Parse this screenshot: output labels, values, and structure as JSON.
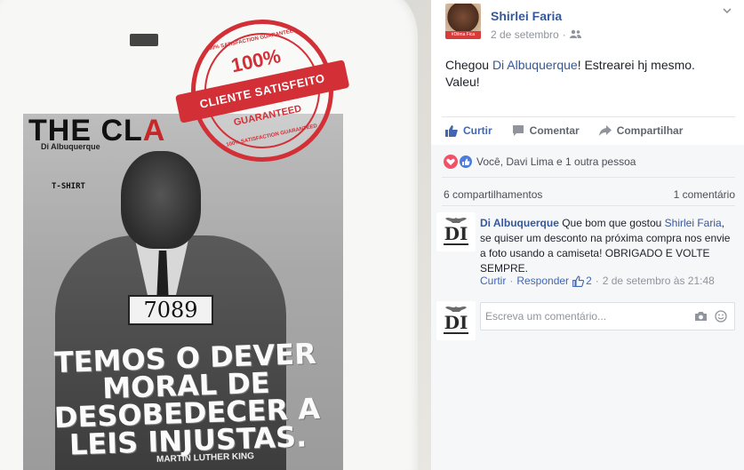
{
  "photo": {
    "print_title_black": "THE CL",
    "print_title_red": "A",
    "print_brand": "Di Albuquerque",
    "print_tshirt": "T-SHIRT",
    "placard_number": "7089",
    "slogan": "TEMOS O DEVER MORAL DE DESOBEDECER A LEIS INJUSTAS.",
    "credit": "MARTIN LUTHER KING",
    "stamp": {
      "ring_top": "100% SATISFACTION GUARANTEED",
      "percent": "100%",
      "band": "CLIENTE SATISFEITO",
      "guaranteed": "GUARANTEED",
      "ring_bottom": "100% SATISFACTION GUARANTEED",
      "color": "#d22f36"
    }
  },
  "post": {
    "author": "Shirlei Faria",
    "avatar_band": "#Dilma Fica",
    "date": "2 de setembro",
    "audience_icon": "friends-icon",
    "text_before": "Chegou ",
    "text_link": "Di Albuquerque",
    "text_after": "! Estrearei hj mesmo. Valeu!"
  },
  "actions": {
    "like": "Curtir",
    "comment": "Comentar",
    "share": "Compartilhar"
  },
  "feedback": {
    "reactions_text": "Você, Davi Lima e 1 outra pessoa",
    "shares": "6 compartilhamentos",
    "comment_count": "1 comentário"
  },
  "comment": {
    "author": "Di Albuquerque",
    "text_before": " Que bom que gostou ",
    "mention": "Shirlei Faria",
    "text_after": ", se quiser um desconto na próxima compra nos envie a foto usando a camiseta! OBRIGADO E VOLTE SEMPRE.",
    "like": "Curtir",
    "separator": "·",
    "reply": "Responder",
    "likes_count": "2",
    "timestamp": "2 de setembro às 21:48"
  },
  "composer": {
    "placeholder": "Escreva um comentário..."
  },
  "colors": {
    "link": "#365899",
    "accent": "#4267b2",
    "muted": "#90949c",
    "feedback_bg": "#f6f7f9"
  }
}
